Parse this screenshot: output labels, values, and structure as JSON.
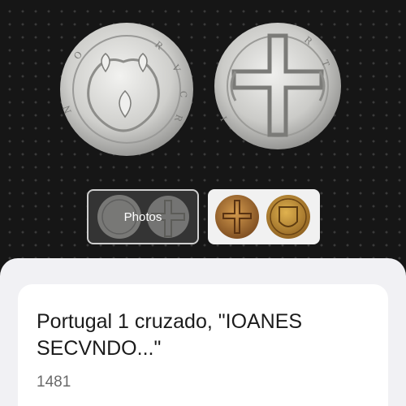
{
  "gallery": {
    "main_image": {
      "subject": "silver coin obverse and reverse"
    },
    "thumbnails": [
      {
        "label": "Photos",
        "selected": true
      },
      {
        "label": "",
        "selected": false
      }
    ]
  },
  "item": {
    "title": "Portugal 1 cruzado, \"IOANES SECVNDO...\"",
    "year": "1481"
  }
}
